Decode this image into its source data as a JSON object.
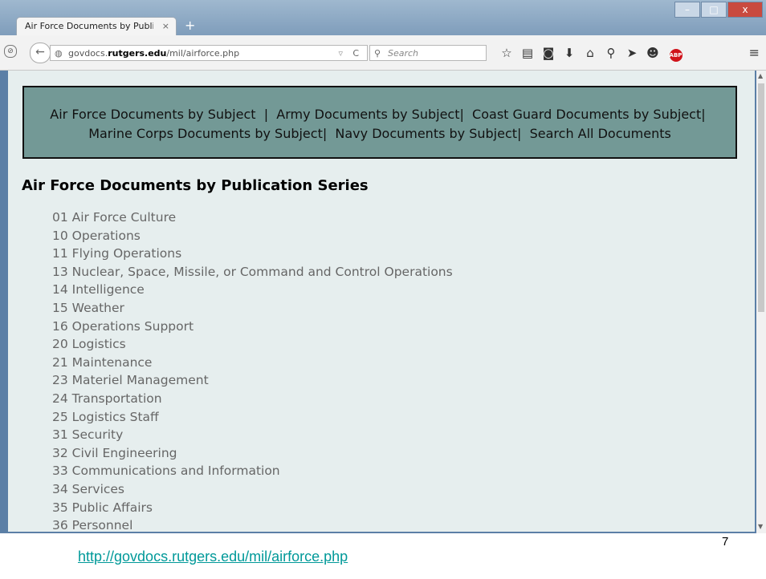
{
  "browser": {
    "tab_title": "Air Force Documents by Public...",
    "tab_close": "×",
    "new_tab": "+",
    "url_prefix": "govdocs.",
    "url_host": "rutgers.edu",
    "url_path": "/mil/airforce.php",
    "search_placeholder": "Search",
    "window_buttons": [
      "–",
      "□",
      "x"
    ]
  },
  "subject_nav": {
    "af": "Air Force Documents by Subject",
    "army": "Army Documents by Subject",
    "cg": "Coast Guard Documents by Subject",
    "mc": "Marine Corps Documents by Subject",
    "navy": "Navy Documents by Subject",
    "search": "Search All Documents",
    "separator": "|"
  },
  "page": {
    "heading": "Air Force Documents by Publication Series",
    "series": [
      "01 Air Force Culture",
      "10 Operations",
      "11 Flying Operations",
      "13 Nuclear, Space, Missile, or Command and Control Operations",
      "14 Intelligence",
      "15 Weather",
      "16 Operations Support",
      "20 Logistics",
      "21 Maintenance",
      "23 Materiel Management",
      "24 Transportation",
      "25 Logistics Staff",
      "31 Security",
      "32 Civil Engineering",
      "33 Communications and Information",
      "34 Services",
      "35 Public Affairs",
      "36 Personnel"
    ]
  },
  "slide": {
    "link": "http://govdocs.rutgers.edu/mil/airforce.php",
    "number": "7"
  }
}
